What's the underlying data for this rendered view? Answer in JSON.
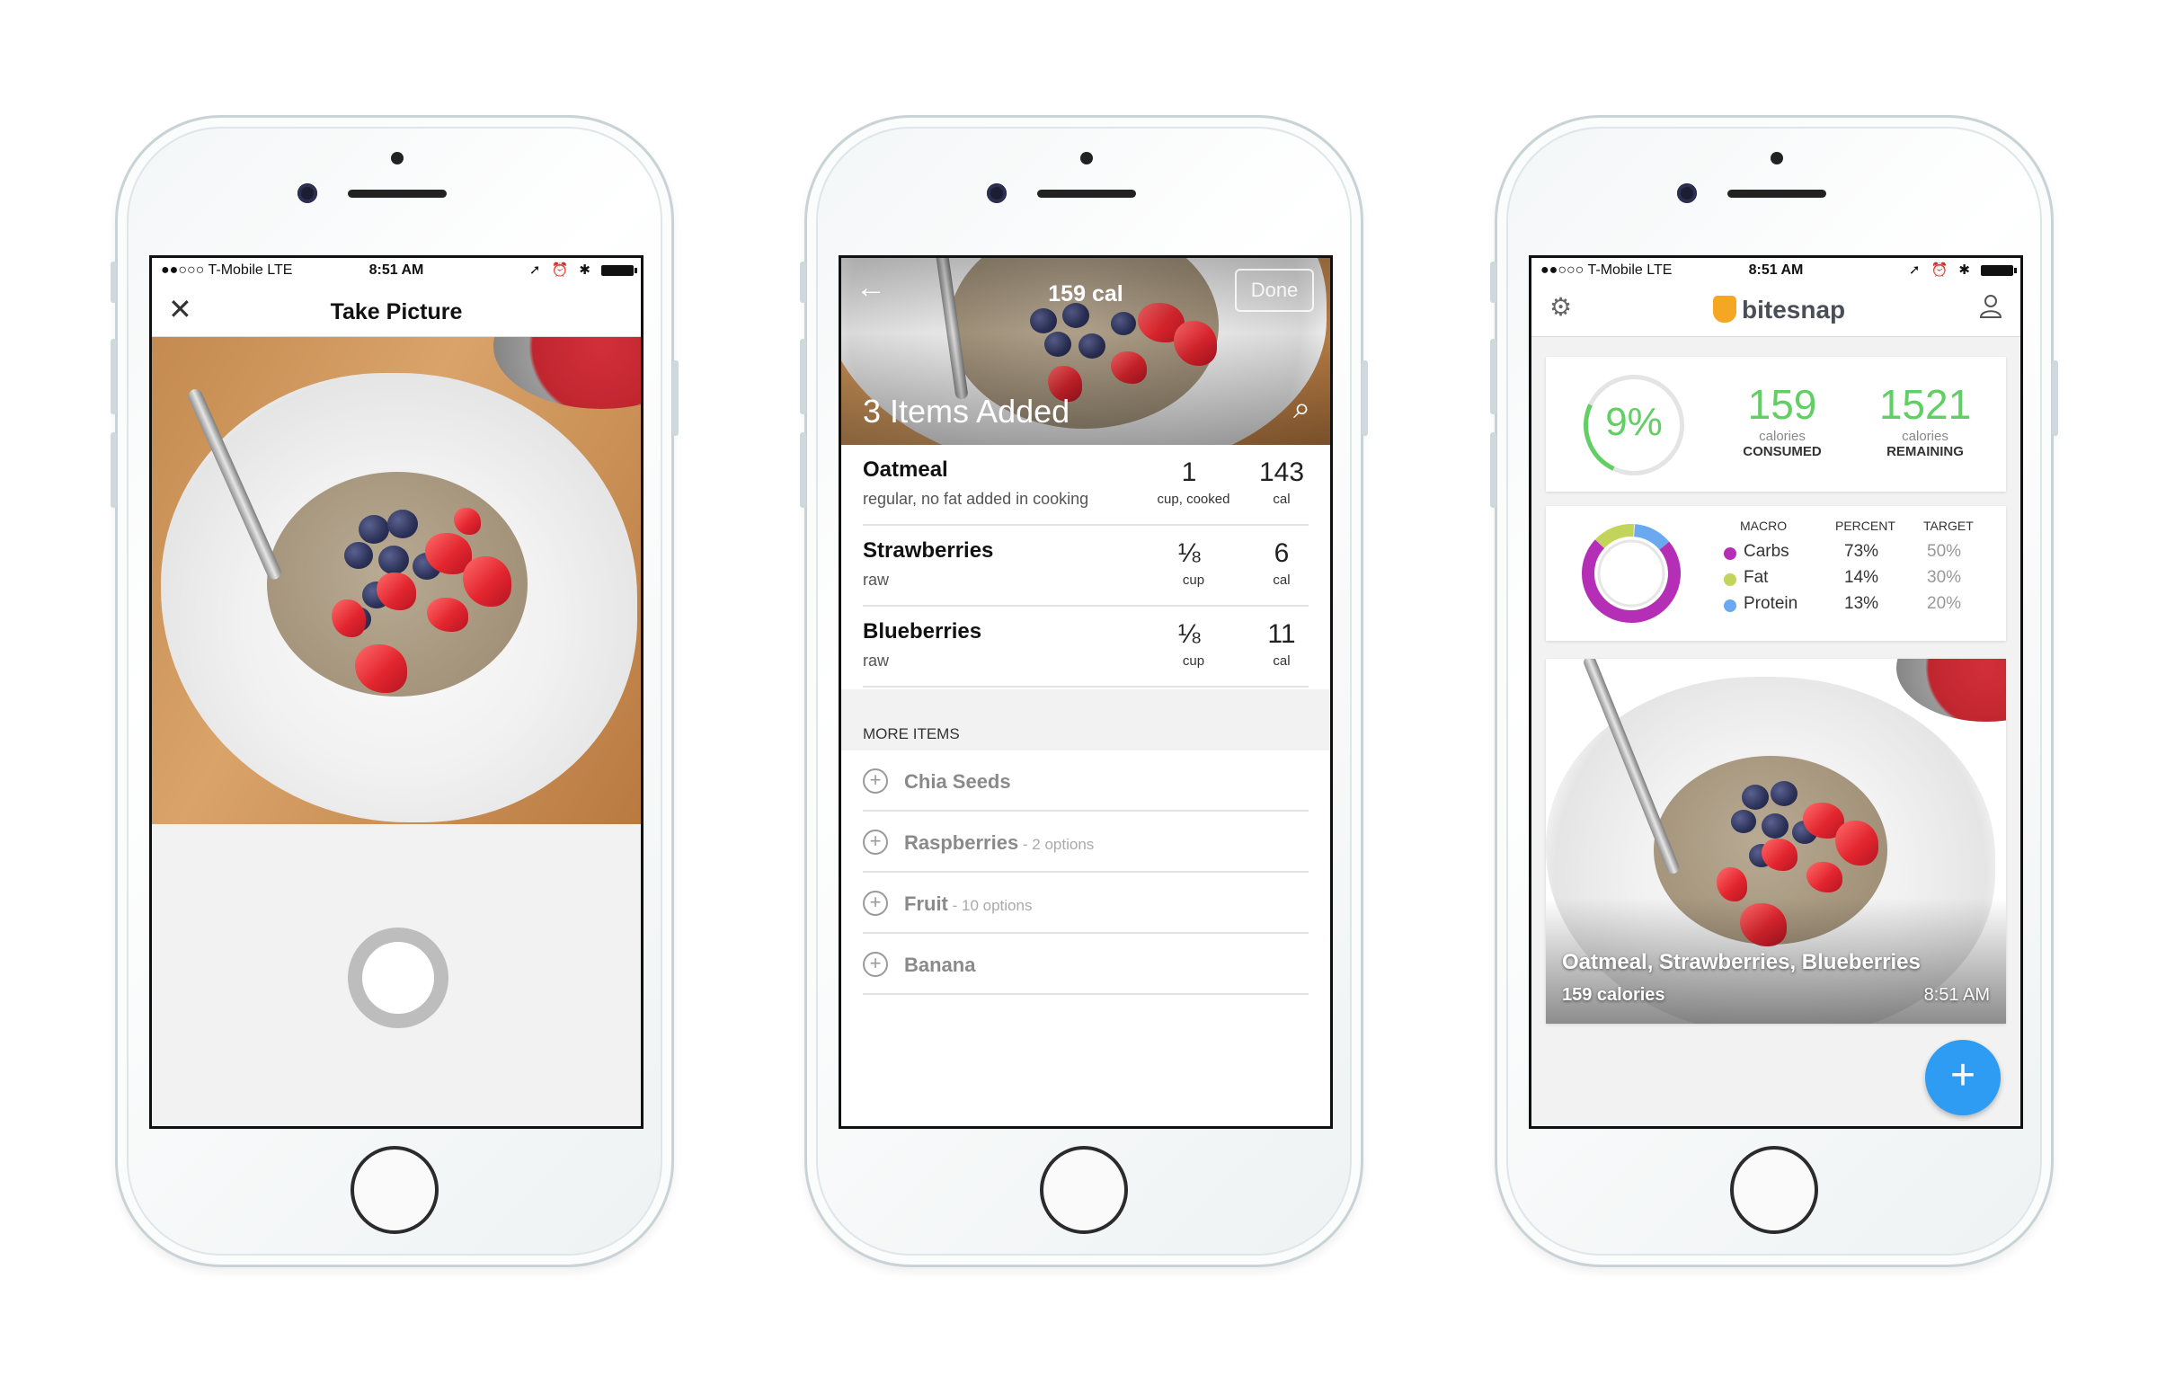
{
  "status_bar": {
    "carrier": "●●○○○ T-Mobile  LTE",
    "time": "8:51 AM",
    "icons": "➚ ⏰ ✱"
  },
  "screen1": {
    "close_icon": "✕",
    "title": "Take Picture"
  },
  "screen2": {
    "back_icon": "←",
    "calories": "159 cal",
    "done_label": "Done",
    "items_added": "3 Items Added",
    "search_icon": "⌕",
    "items": [
      {
        "name": "Oatmeal",
        "desc": "regular, no fat added in cooking",
        "qty": "1",
        "unit": "cup, cooked",
        "cal": "143",
        "cal_unit": "cal"
      },
      {
        "name": "Strawberries",
        "desc": "raw",
        "qty": "⅛",
        "unit": "cup",
        "cal": "6",
        "cal_unit": "cal"
      },
      {
        "name": "Blueberries",
        "desc": "raw",
        "qty": "⅛",
        "unit": "cup",
        "cal": "11",
        "cal_unit": "cal"
      }
    ],
    "more_items_header": "MORE ITEMS",
    "more_items": [
      {
        "label": "Chia Seeds",
        "options": ""
      },
      {
        "label": "Raspberries",
        "options": " - 2 options"
      },
      {
        "label": "Fruit",
        "options": " - 10 options"
      },
      {
        "label": "Banana",
        "options": ""
      }
    ]
  },
  "screen3": {
    "gear_icon": "⚙",
    "brand": "bitesnap",
    "user_icon": "👤",
    "percent": "9%",
    "consumed": {
      "value": "159",
      "caption": "calories",
      "label": "CONSUMED"
    },
    "remaining": {
      "value": "1521",
      "caption": "calories",
      "label": "REMAINING"
    },
    "macro_headers": {
      "macro": "MACRO",
      "percent": "PERCENT",
      "target": "TARGET"
    },
    "macros": [
      {
        "name": "Carbs",
        "percent": "73%",
        "target": "50%",
        "color": "#b42fb6"
      },
      {
        "name": "Fat",
        "percent": "14%",
        "target": "30%",
        "color": "#c3d45a"
      },
      {
        "name": "Protein",
        "percent": "13%",
        "target": "20%",
        "color": "#6aa8f0"
      }
    ],
    "meal_title": "Oatmeal, Strawberries, Blueberries",
    "meal_calories": "159 calories",
    "meal_time": "8:51 AM",
    "fab_icon": "+"
  },
  "colors": {
    "accent_green": "#61cf63",
    "fab_blue": "#2d9cf2",
    "carbs": "#b42fb6",
    "fat": "#c3d45a",
    "protein": "#6aa8f0"
  }
}
